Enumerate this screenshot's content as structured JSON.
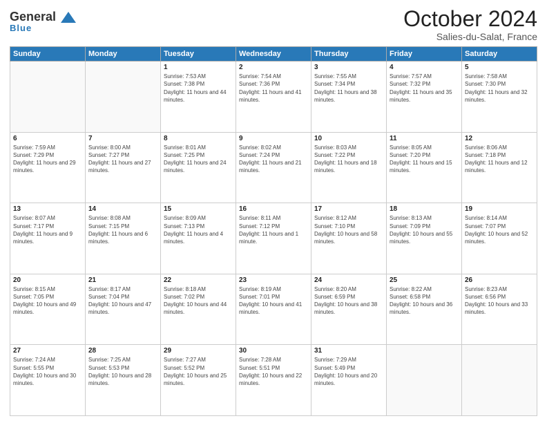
{
  "header": {
    "logo_general": "General",
    "logo_blue": "Blue",
    "calendar_title": "October 2024",
    "calendar_subtitle": "Salies-du-Salat, France"
  },
  "weekdays": [
    "Sunday",
    "Monday",
    "Tuesday",
    "Wednesday",
    "Thursday",
    "Friday",
    "Saturday"
  ],
  "weeks": [
    [
      {
        "num": "",
        "empty": true
      },
      {
        "num": "",
        "empty": true
      },
      {
        "num": "1",
        "sunrise": "Sunrise: 7:53 AM",
        "sunset": "Sunset: 7:38 PM",
        "daylight": "Daylight: 11 hours and 44 minutes."
      },
      {
        "num": "2",
        "sunrise": "Sunrise: 7:54 AM",
        "sunset": "Sunset: 7:36 PM",
        "daylight": "Daylight: 11 hours and 41 minutes."
      },
      {
        "num": "3",
        "sunrise": "Sunrise: 7:55 AM",
        "sunset": "Sunset: 7:34 PM",
        "daylight": "Daylight: 11 hours and 38 minutes."
      },
      {
        "num": "4",
        "sunrise": "Sunrise: 7:57 AM",
        "sunset": "Sunset: 7:32 PM",
        "daylight": "Daylight: 11 hours and 35 minutes."
      },
      {
        "num": "5",
        "sunrise": "Sunrise: 7:58 AM",
        "sunset": "Sunset: 7:30 PM",
        "daylight": "Daylight: 11 hours and 32 minutes."
      }
    ],
    [
      {
        "num": "6",
        "sunrise": "Sunrise: 7:59 AM",
        "sunset": "Sunset: 7:29 PM",
        "daylight": "Daylight: 11 hours and 29 minutes."
      },
      {
        "num": "7",
        "sunrise": "Sunrise: 8:00 AM",
        "sunset": "Sunset: 7:27 PM",
        "daylight": "Daylight: 11 hours and 27 minutes."
      },
      {
        "num": "8",
        "sunrise": "Sunrise: 8:01 AM",
        "sunset": "Sunset: 7:25 PM",
        "daylight": "Daylight: 11 hours and 24 minutes."
      },
      {
        "num": "9",
        "sunrise": "Sunrise: 8:02 AM",
        "sunset": "Sunset: 7:24 PM",
        "daylight": "Daylight: 11 hours and 21 minutes."
      },
      {
        "num": "10",
        "sunrise": "Sunrise: 8:03 AM",
        "sunset": "Sunset: 7:22 PM",
        "daylight": "Daylight: 11 hours and 18 minutes."
      },
      {
        "num": "11",
        "sunrise": "Sunrise: 8:05 AM",
        "sunset": "Sunset: 7:20 PM",
        "daylight": "Daylight: 11 hours and 15 minutes."
      },
      {
        "num": "12",
        "sunrise": "Sunrise: 8:06 AM",
        "sunset": "Sunset: 7:18 PM",
        "daylight": "Daylight: 11 hours and 12 minutes."
      }
    ],
    [
      {
        "num": "13",
        "sunrise": "Sunrise: 8:07 AM",
        "sunset": "Sunset: 7:17 PM",
        "daylight": "Daylight: 11 hours and 9 minutes."
      },
      {
        "num": "14",
        "sunrise": "Sunrise: 8:08 AM",
        "sunset": "Sunset: 7:15 PM",
        "daylight": "Daylight: 11 hours and 6 minutes."
      },
      {
        "num": "15",
        "sunrise": "Sunrise: 8:09 AM",
        "sunset": "Sunset: 7:13 PM",
        "daylight": "Daylight: 11 hours and 4 minutes."
      },
      {
        "num": "16",
        "sunrise": "Sunrise: 8:11 AM",
        "sunset": "Sunset: 7:12 PM",
        "daylight": "Daylight: 11 hours and 1 minute."
      },
      {
        "num": "17",
        "sunrise": "Sunrise: 8:12 AM",
        "sunset": "Sunset: 7:10 PM",
        "daylight": "Daylight: 10 hours and 58 minutes."
      },
      {
        "num": "18",
        "sunrise": "Sunrise: 8:13 AM",
        "sunset": "Sunset: 7:09 PM",
        "daylight": "Daylight: 10 hours and 55 minutes."
      },
      {
        "num": "19",
        "sunrise": "Sunrise: 8:14 AM",
        "sunset": "Sunset: 7:07 PM",
        "daylight": "Daylight: 10 hours and 52 minutes."
      }
    ],
    [
      {
        "num": "20",
        "sunrise": "Sunrise: 8:15 AM",
        "sunset": "Sunset: 7:05 PM",
        "daylight": "Daylight: 10 hours and 49 minutes."
      },
      {
        "num": "21",
        "sunrise": "Sunrise: 8:17 AM",
        "sunset": "Sunset: 7:04 PM",
        "daylight": "Daylight: 10 hours and 47 minutes."
      },
      {
        "num": "22",
        "sunrise": "Sunrise: 8:18 AM",
        "sunset": "Sunset: 7:02 PM",
        "daylight": "Daylight: 10 hours and 44 minutes."
      },
      {
        "num": "23",
        "sunrise": "Sunrise: 8:19 AM",
        "sunset": "Sunset: 7:01 PM",
        "daylight": "Daylight: 10 hours and 41 minutes."
      },
      {
        "num": "24",
        "sunrise": "Sunrise: 8:20 AM",
        "sunset": "Sunset: 6:59 PM",
        "daylight": "Daylight: 10 hours and 38 minutes."
      },
      {
        "num": "25",
        "sunrise": "Sunrise: 8:22 AM",
        "sunset": "Sunset: 6:58 PM",
        "daylight": "Daylight: 10 hours and 36 minutes."
      },
      {
        "num": "26",
        "sunrise": "Sunrise: 8:23 AM",
        "sunset": "Sunset: 6:56 PM",
        "daylight": "Daylight: 10 hours and 33 minutes."
      }
    ],
    [
      {
        "num": "27",
        "sunrise": "Sunrise: 7:24 AM",
        "sunset": "Sunset: 5:55 PM",
        "daylight": "Daylight: 10 hours and 30 minutes."
      },
      {
        "num": "28",
        "sunrise": "Sunrise: 7:25 AM",
        "sunset": "Sunset: 5:53 PM",
        "daylight": "Daylight: 10 hours and 28 minutes."
      },
      {
        "num": "29",
        "sunrise": "Sunrise: 7:27 AM",
        "sunset": "Sunset: 5:52 PM",
        "daylight": "Daylight: 10 hours and 25 minutes."
      },
      {
        "num": "30",
        "sunrise": "Sunrise: 7:28 AM",
        "sunset": "Sunset: 5:51 PM",
        "daylight": "Daylight: 10 hours and 22 minutes."
      },
      {
        "num": "31",
        "sunrise": "Sunrise: 7:29 AM",
        "sunset": "Sunset: 5:49 PM",
        "daylight": "Daylight: 10 hours and 20 minutes."
      },
      {
        "num": "",
        "empty": true
      },
      {
        "num": "",
        "empty": true
      }
    ]
  ]
}
